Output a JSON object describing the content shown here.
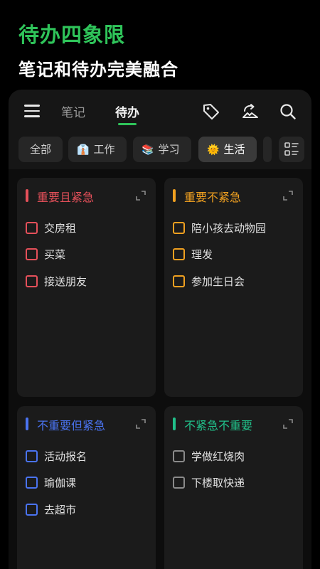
{
  "promo": {
    "title": "待办四象限",
    "subtitle": "笔记和待办完美融合"
  },
  "topbar": {
    "tabs": [
      {
        "label": "笔记",
        "active": false
      },
      {
        "label": "待办",
        "active": true
      }
    ],
    "icons": [
      "menu-icon",
      "tag-icon",
      "sync-icon",
      "search-icon"
    ]
  },
  "filters": [
    {
      "label": "全部",
      "emoji": "",
      "active": false
    },
    {
      "label": "工作",
      "emoji": "👔",
      "active": false
    },
    {
      "label": "学习",
      "emoji": "📚",
      "active": false
    },
    {
      "label": "生活",
      "emoji": "🌞",
      "active": true
    }
  ],
  "quadrants": [
    {
      "title": "重要且紧急",
      "color": "#e5505a",
      "tasks": [
        "交房租",
        "买菜",
        "接送朋友"
      ]
    },
    {
      "title": "重要不紧急",
      "color": "#f0a020",
      "tasks": [
        "陪小孩去动物园",
        "理发",
        "参加生日会"
      ]
    },
    {
      "title": "不重要但紧急",
      "color": "#4a73f0",
      "tasks": [
        "活动报名",
        "瑜伽课",
        "去超市"
      ]
    },
    {
      "title": "不紧急不重要",
      "color": "#21c08a",
      "tasks": [
        "学做红烧肉",
        "下楼取快递"
      ],
      "box_color": "#8a8a8a"
    }
  ],
  "colors": {
    "accent": "#2fc45a",
    "background": "#000000",
    "panel": "#161616",
    "card": "#1b1b1b"
  }
}
